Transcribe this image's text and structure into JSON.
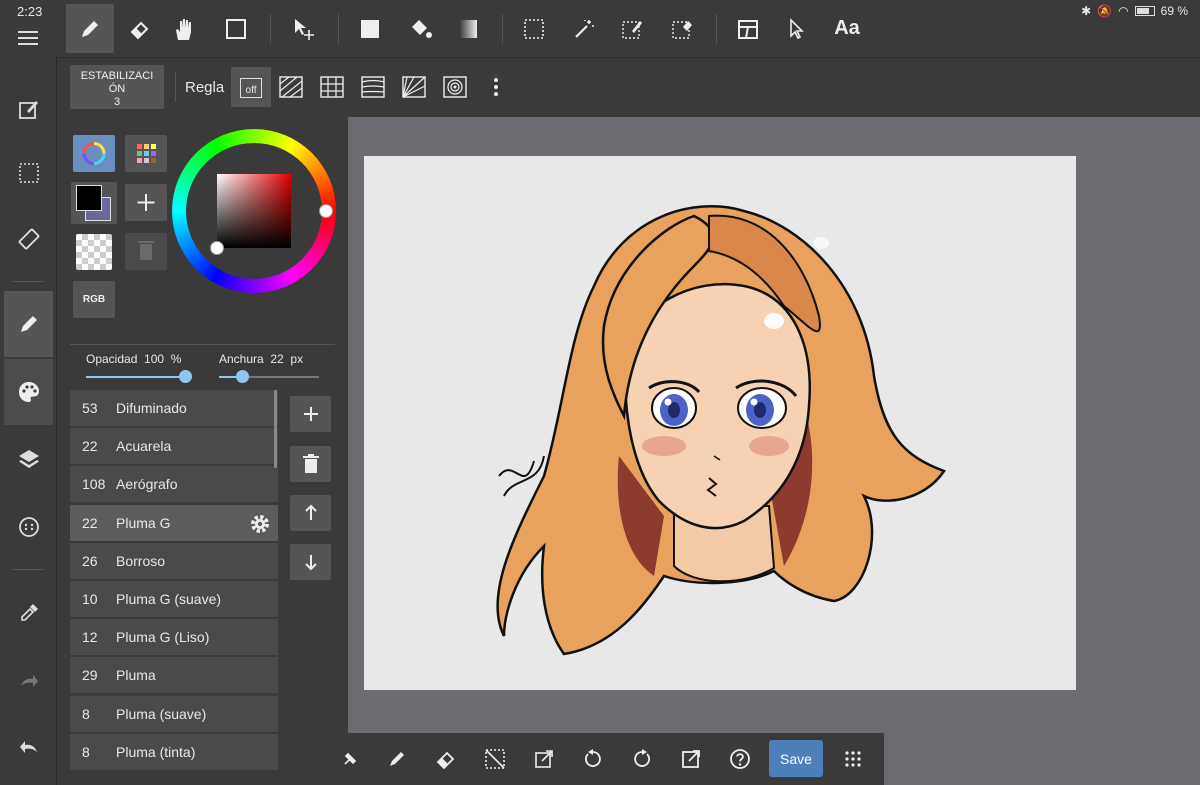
{
  "status_bar": {
    "time": "2:23",
    "battery": "69 %"
  },
  "toolbar": {
    "tools": [
      "pen-icon",
      "eraser-icon",
      "hand-icon",
      "shape-icon",
      "move-icon",
      "fill-rect-icon",
      "bucket-icon",
      "gradient-icon",
      "select-rect-icon",
      "magic-wand-icon",
      "select-pen-icon",
      "select-eraser-icon",
      "layout-icon",
      "pointer-icon"
    ],
    "text_tool": "Aa"
  },
  "subbar": {
    "stabilization_label": "ESTABILIZACIÓN",
    "stabilization_value": "3",
    "ruler_label": "Regla",
    "ruler_off": "off"
  },
  "color_panel": {
    "rgb_label": "RGB",
    "accent": "#8ec8f0"
  },
  "sliders": {
    "opacity_label": "Opacidad",
    "opacity_value": "100",
    "opacity_unit": "%",
    "opacity_level": 1.0,
    "width_label": "Anchura",
    "width_value": "22",
    "width_unit": "px"
  },
  "brushes": [
    {
      "size": "53",
      "name": "Difuminado"
    },
    {
      "size": "22",
      "name": "Acuarela"
    },
    {
      "size": "108",
      "name": "Aerógrafo"
    },
    {
      "size": "22",
      "name": "Pluma G",
      "selected": true
    },
    {
      "size": "26",
      "name": "Borroso"
    },
    {
      "size": "10",
      "name": "Pluma G (suave)"
    },
    {
      "size": "12",
      "name": "Pluma G (Liso)"
    },
    {
      "size": "29",
      "name": "Pluma"
    },
    {
      "size": "8",
      "name": "Pluma (suave)"
    },
    {
      "size": "8",
      "name": "Pluma (tinta)"
    }
  ],
  "bottom_bar": {
    "save_label": "Save"
  }
}
